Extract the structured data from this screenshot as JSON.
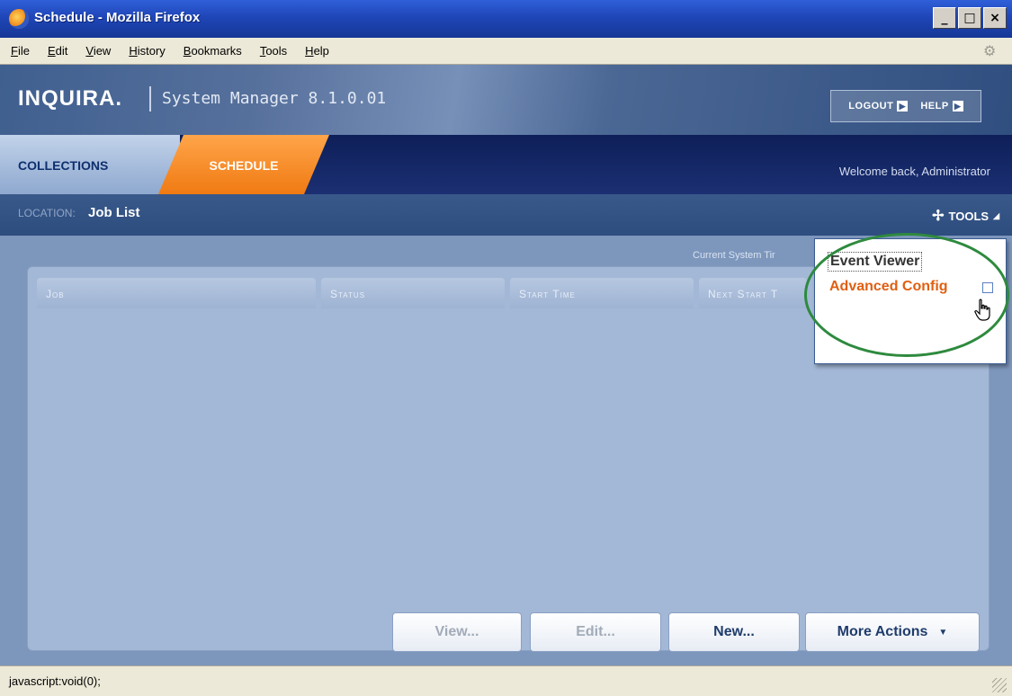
{
  "window": {
    "title": "Schedule - Mozilla Firefox",
    "controls": {
      "minimize": "_",
      "maximize": "□",
      "close": "×"
    }
  },
  "menubar": {
    "items": [
      "File",
      "Edit",
      "View",
      "History",
      "Bookmarks",
      "Tools",
      "Help"
    ]
  },
  "header": {
    "brand": "INQUIRA.",
    "product": "System Manager 8.1.0.01",
    "logout_label": "LOGOUT",
    "help_label": "HELP"
  },
  "tabs": {
    "items": [
      {
        "label": "COLLECTIONS",
        "active": false
      },
      {
        "label": "SCHEDULE",
        "active": true
      }
    ],
    "welcome": "Welcome back, Administrator"
  },
  "location": {
    "label": "LOCATION:",
    "value": "Job List",
    "tools_label": "TOOLS"
  },
  "content": {
    "system_time_label": "Current System Tir",
    "columns": [
      "Job",
      "Status",
      "Start Time",
      "Next Start T"
    ]
  },
  "tools_menu": {
    "items": [
      "Event Viewer",
      "Advanced Config"
    ]
  },
  "actions": {
    "view": "View...",
    "edit": "Edit...",
    "new": "New...",
    "more": "More Actions"
  },
  "statusbar": {
    "text": "javascript:void(0);"
  },
  "colors": {
    "accent": "#f07a12",
    "nav_dark": "#0e1f59",
    "panel": "#a3b8d6",
    "highlight": "#2e8a3e"
  },
  "icons": {
    "window": "firefox-icon",
    "tools": "tools-icon",
    "external": "external-link-icon",
    "cursor": "hand-cursor-icon"
  }
}
